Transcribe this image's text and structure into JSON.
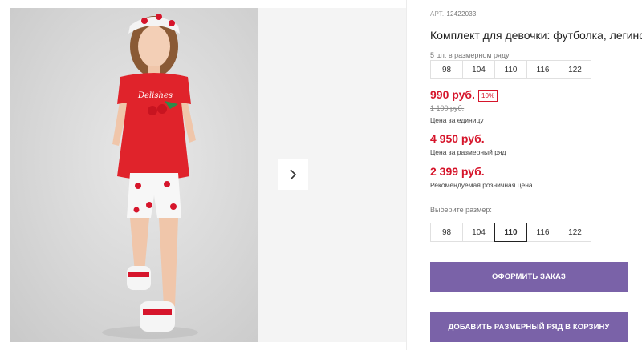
{
  "product": {
    "article_label": "АРТ.",
    "article": "12422033",
    "title": "Комплект для девочки: футболка, легинсы"
  },
  "pack": {
    "label": "5 шт. в размерном ряду",
    "sizes": [
      "98",
      "104",
      "110",
      "116",
      "122"
    ]
  },
  "prices": {
    "unit": "990 руб.",
    "discount": "10%",
    "old": "1 100 руб.",
    "unit_note": "Цена за единицу",
    "pack": "4 950 руб.",
    "pack_note": "Цена за размерный ряд",
    "retail": "2 399 руб.",
    "retail_note": "Рекомендуемая розничная цена"
  },
  "size_select": {
    "label": "Выберите размер:",
    "options": [
      "98",
      "104",
      "110",
      "116",
      "122"
    ],
    "selected": "110"
  },
  "buttons": {
    "order": "ОФОРМИТЬ ЗАКАЗ",
    "add_pack": "ДОБАВИТЬ РАЗМЕРНЫЙ РЯД В КОРЗИНУ"
  },
  "gallery": {
    "next_icon": "chevron-right-icon"
  },
  "colors": {
    "accent": "#7a62a8",
    "price": "#d6152b"
  }
}
